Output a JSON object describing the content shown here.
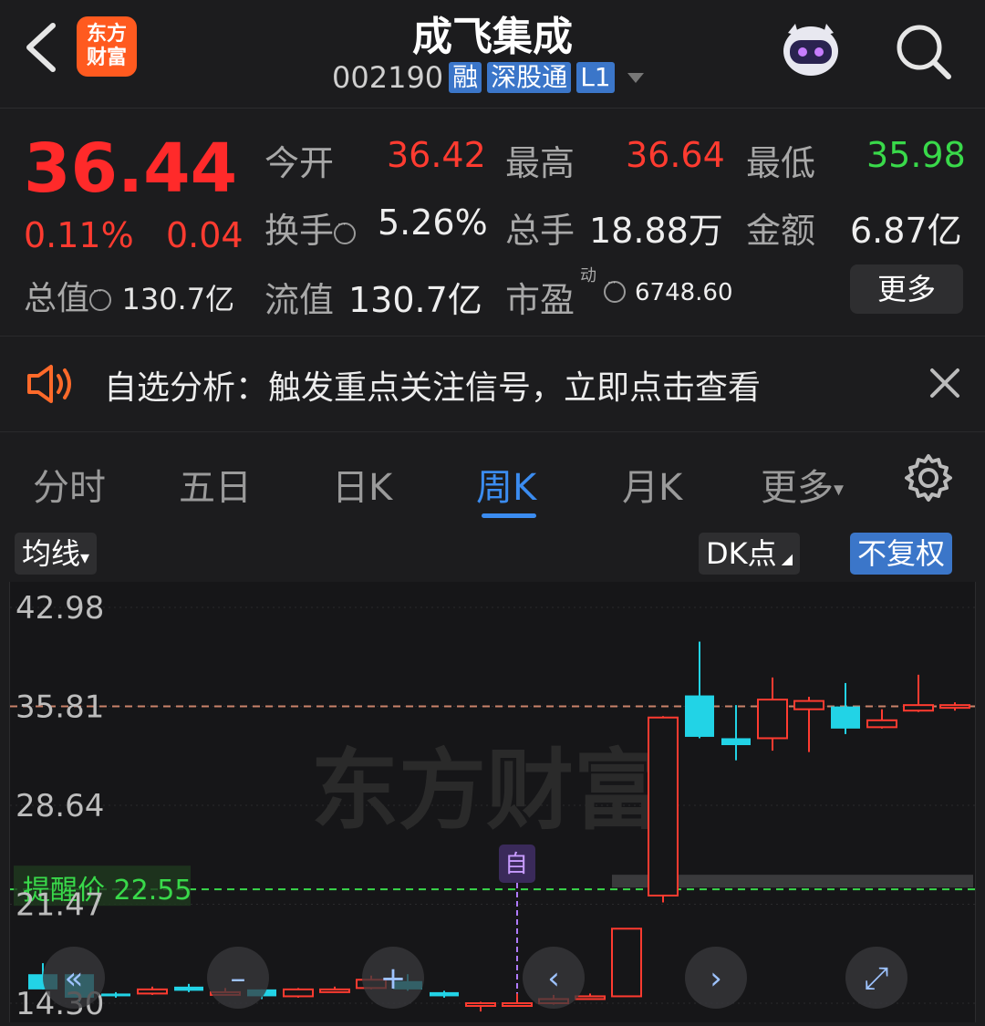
{
  "header": {
    "back_icon": "chevron-left-icon",
    "logo_text_line1": "东方",
    "logo_text_line2": "财富",
    "stock_name": "成飞集成",
    "stock_code": "002190",
    "tags": [
      "融",
      "深股通",
      "L1"
    ],
    "avatar_icon": "robot-avatar-icon",
    "search_icon": "search-icon"
  },
  "quote": {
    "price": "36.44",
    "change_pct": "0.11%",
    "change_amt": "0.04",
    "total_value_label": "总值",
    "total_value": "130.7亿",
    "open_label": "今开",
    "open": "36.42",
    "high_label": "最高",
    "high": "36.64",
    "low_label": "最低",
    "low": "35.98",
    "turnover_label": "换手",
    "turnover": "5.26%",
    "volume_label": "总手",
    "volume": "18.88万",
    "amount_label": "金额",
    "amount": "6.87亿",
    "float_value_label": "流值",
    "float_value": "130.7亿",
    "pe_label": "市盈",
    "pe_sup": "动",
    "pe": "6748.60",
    "more_label": "更多",
    "colors": {
      "up": "#ff3b30",
      "down": "#39d94a"
    }
  },
  "notice": {
    "text": "自选分析：触发重点关注信号，立即点击查看",
    "speaker_icon": "speaker-icon",
    "close_icon": "close-icon"
  },
  "tabs": {
    "items": [
      "分时",
      "五日",
      "日K",
      "周K",
      "月K",
      "更多"
    ],
    "active": "周K",
    "settings_icon": "gear-icon"
  },
  "chart_controls": {
    "ma_label": "均线",
    "dk_label": "DK点",
    "adjust_label": "不复权"
  },
  "chart_data": {
    "type": "candlestick",
    "y_ticks": [
      "42.98",
      "35.81",
      "28.64",
      "21.47",
      "14.30"
    ],
    "ylim": [
      14.3,
      42.98
    ],
    "reference_price": 35.81,
    "alert_label": "提醒价",
    "alert_price": "22.55",
    "marker_label": "自",
    "watermark": "东方财富",
    "candles": [
      {
        "o": 16.4,
        "c": 15.3,
        "h": 17.2,
        "l": 15.3
      },
      {
        "o": 16.4,
        "c": 14.7,
        "h": 16.4,
        "l": 14.4
      },
      {
        "o": 15.0,
        "c": 14.8,
        "h": 15.1,
        "l": 14.7
      },
      {
        "o": 15.0,
        "c": 15.3,
        "h": 15.5,
        "l": 14.9
      },
      {
        "o": 15.5,
        "c": 15.2,
        "h": 15.7,
        "l": 15.1
      },
      {
        "o": 15.0,
        "c": 15.1,
        "h": 15.4,
        "l": 14.9
      },
      {
        "o": 15.3,
        "c": 14.8,
        "h": 15.3,
        "l": 14.6
      },
      {
        "o": 14.8,
        "c": 15.3,
        "h": 15.4,
        "l": 14.7
      },
      {
        "o": 15.3,
        "c": 15.3,
        "h": 15.5,
        "l": 15.1
      },
      {
        "o": 15.4,
        "c": 16.0,
        "h": 16.3,
        "l": 15.3
      },
      {
        "o": 15.9,
        "c": 15.3,
        "h": 16.4,
        "l": 15.2
      },
      {
        "o": 15.1,
        "c": 14.8,
        "h": 15.2,
        "l": 14.7
      },
      {
        "o": 14.3,
        "c": 14.3,
        "h": 14.4,
        "l": 13.7
      },
      {
        "o": 14.3,
        "c": 14.3,
        "h": 15.0,
        "l": 14.3
      },
      {
        "o": 14.3,
        "c": 14.6,
        "h": 14.9,
        "l": 14.2
      },
      {
        "o": 14.6,
        "c": 14.8,
        "h": 15.0,
        "l": 14.6
      },
      {
        "o": 14.8,
        "c": 19.7,
        "h": 19.7,
        "l": 14.8
      },
      {
        "o": 22.1,
        "c": 35.0,
        "h": 35.1,
        "l": 21.6
      },
      {
        "o": 36.6,
        "c": 33.6,
        "h": 40.5,
        "l": 33.5
      },
      {
        "o": 33.5,
        "c": 33.0,
        "h": 35.9,
        "l": 31.9
      },
      {
        "o": 33.5,
        "c": 36.3,
        "h": 37.9,
        "l": 32.6
      },
      {
        "o": 35.6,
        "c": 36.2,
        "h": 36.5,
        "l": 32.5
      },
      {
        "o": 35.8,
        "c": 34.2,
        "h": 37.5,
        "l": 33.8
      },
      {
        "o": 34.3,
        "c": 34.8,
        "h": 35.6,
        "l": 34.2
      },
      {
        "o": 35.5,
        "c": 35.9,
        "h": 38.1,
        "l": 35.4
      },
      {
        "o": 35.8,
        "c": 35.9,
        "h": 36.1,
        "l": 35.5
      }
    ]
  }
}
